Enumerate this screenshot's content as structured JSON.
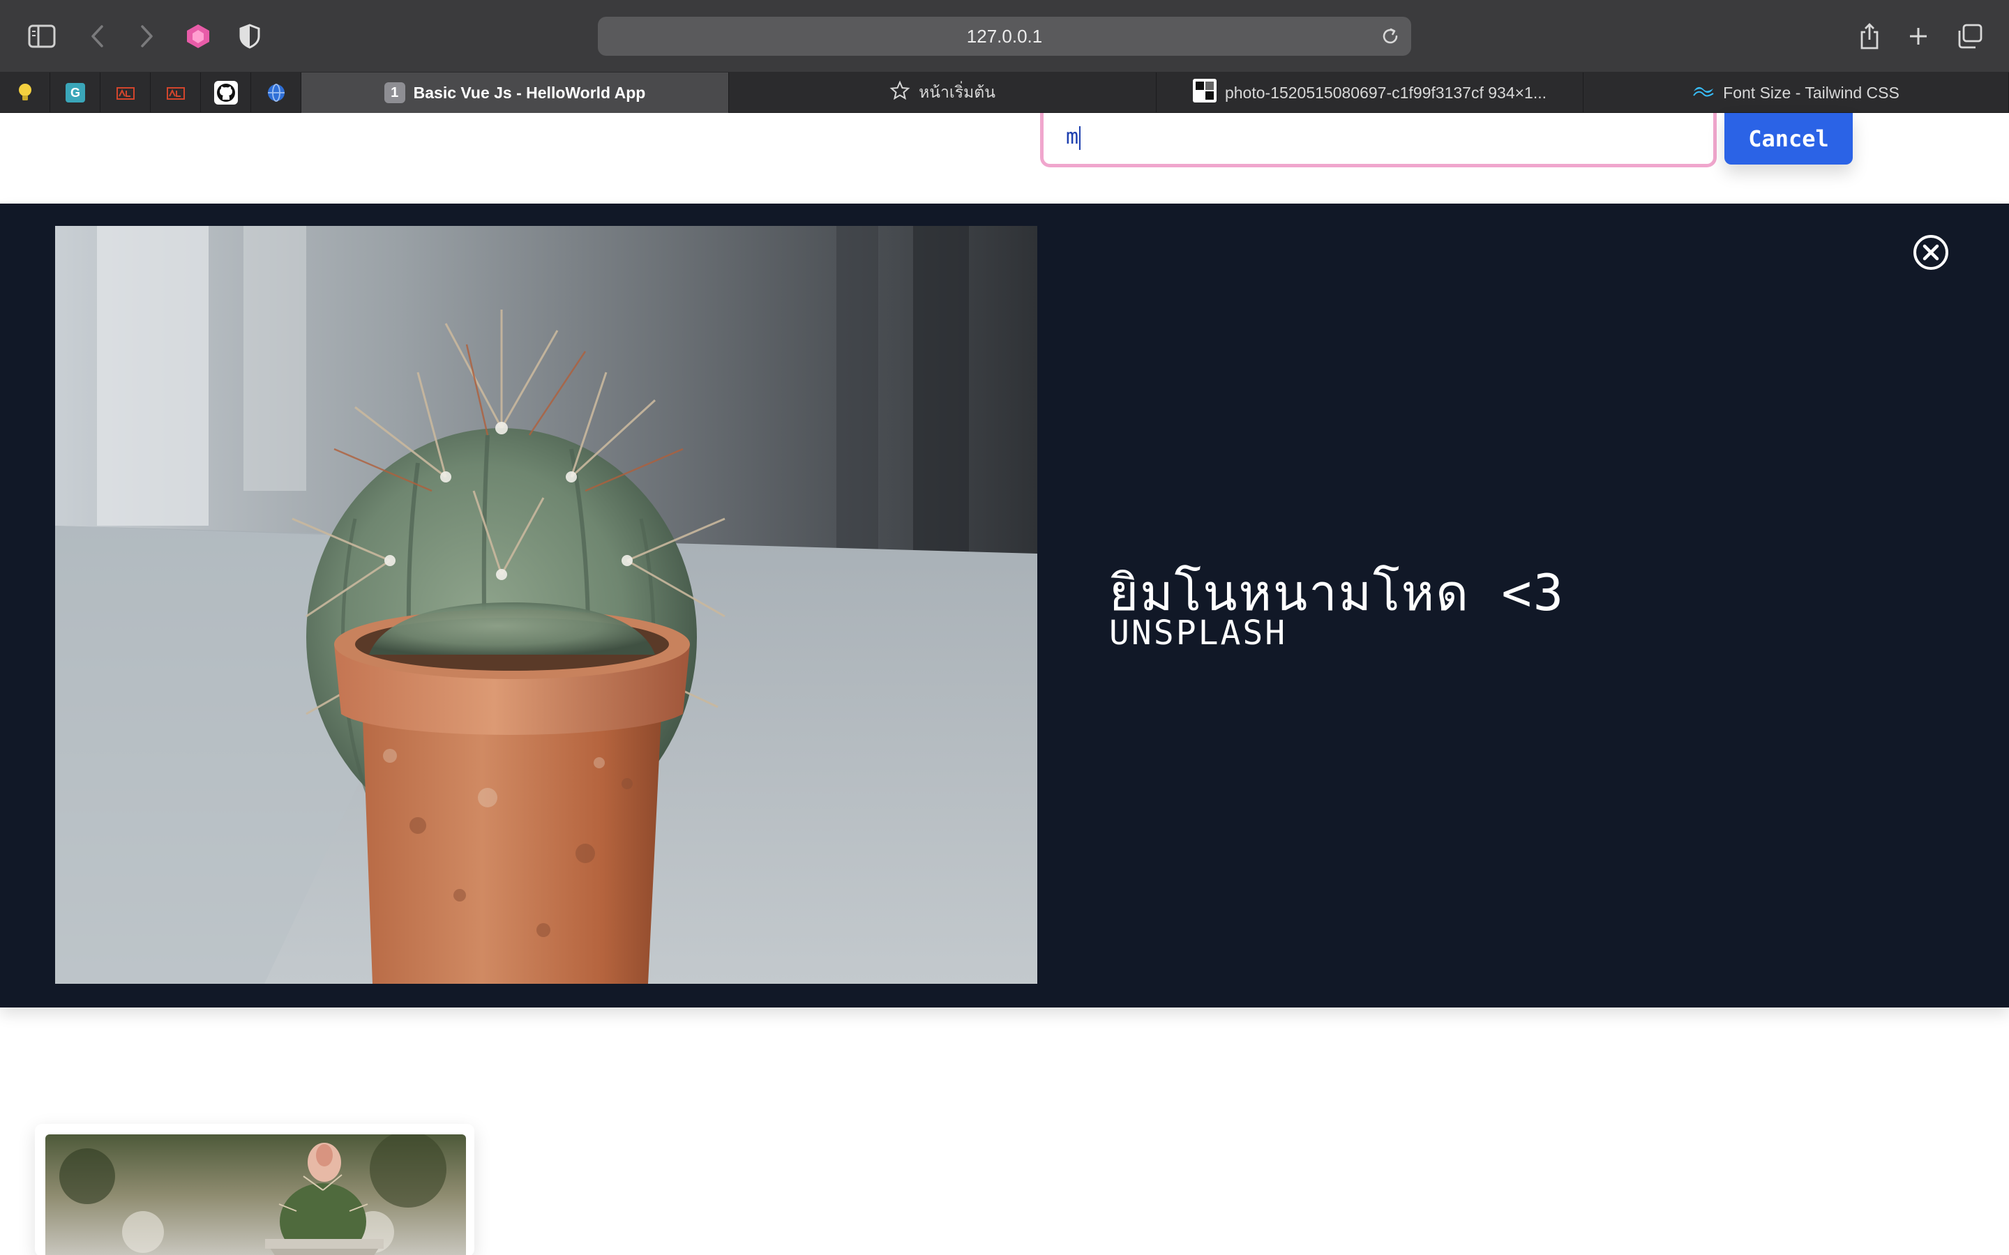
{
  "browser": {
    "url": "127.0.0.1",
    "tabs": [
      {
        "label": "Basic Vue Js - HelloWorld App",
        "badge": "1",
        "active": true
      },
      {
        "label": "หน้าเริ่มต้น",
        "active": false
      },
      {
        "label": "photo-1520515080697-c1f99f3137cf 934×1...",
        "active": false
      },
      {
        "label": "Font Size - Tailwind CSS",
        "active": false
      }
    ]
  },
  "search": {
    "value": "m",
    "cancel_label": "Cancel"
  },
  "modal": {
    "title": "ยิมโนหนามโหด <3",
    "subtitle": "UNSPLASH",
    "background": "#111827"
  },
  "colors": {
    "accent": "#2b63e6",
    "input_border": "#f0a6cd"
  }
}
